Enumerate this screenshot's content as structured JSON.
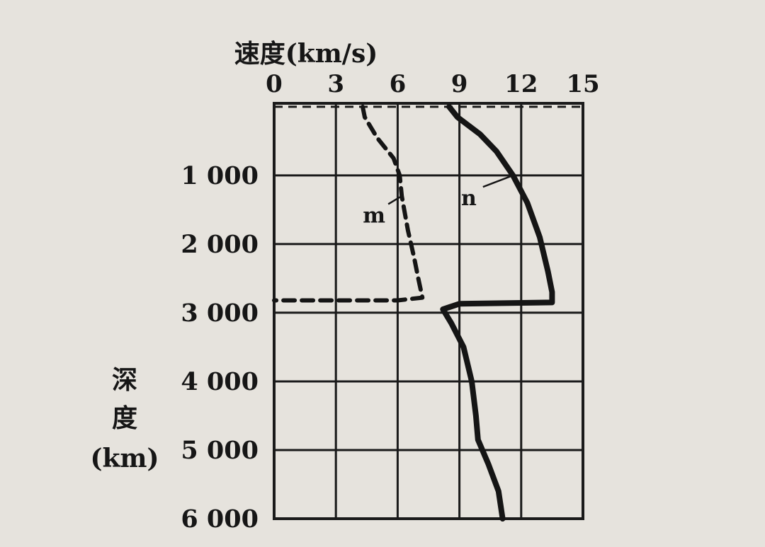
{
  "chart_data": {
    "type": "line",
    "title": "",
    "xlabel": "速度(km/s)",
    "ylabel": {
      "line1": "深",
      "line2": "度",
      "line3": "(km)"
    },
    "x_axis": {
      "position": "top",
      "range": [
        0,
        15
      ],
      "ticks": [
        0,
        3,
        6,
        9,
        12,
        15
      ],
      "tick_labels": [
        "0",
        "3",
        "6",
        "9",
        "12",
        "15"
      ]
    },
    "y_axis": {
      "inverted": true,
      "range": [
        -50,
        6000
      ],
      "ticks": [
        1000,
        2000,
        3000,
        4000,
        5000,
        6000
      ],
      "tick_labels": [
        "1 000",
        "2 000",
        "3 000",
        "4 000",
        "5 000",
        "6 000"
      ]
    },
    "grid": true,
    "series": [
      {
        "name": "m",
        "style": "dashed",
        "points": [
          [
            4.3,
            0
          ],
          [
            4.4,
            150
          ],
          [
            5.0,
            450
          ],
          [
            5.8,
            750
          ],
          [
            6.1,
            1000
          ],
          [
            6.2,
            1300
          ],
          [
            6.5,
            1800
          ],
          [
            6.8,
            2200
          ],
          [
            7.0,
            2500
          ],
          [
            7.2,
            2780
          ],
          [
            6.0,
            2820
          ],
          [
            0,
            2820
          ]
        ]
      },
      {
        "name": "n",
        "style": "solid",
        "points": [
          [
            8.5,
            0
          ],
          [
            8.9,
            150
          ],
          [
            10.0,
            400
          ],
          [
            10.8,
            650
          ],
          [
            11.6,
            1000
          ],
          [
            12.3,
            1400
          ],
          [
            12.9,
            1900
          ],
          [
            13.3,
            2400
          ],
          [
            13.5,
            2700
          ],
          [
            13.5,
            2850
          ],
          [
            9.0,
            2870
          ],
          [
            8.2,
            2950
          ],
          [
            8.6,
            3150
          ],
          [
            9.2,
            3500
          ],
          [
            9.6,
            4000
          ],
          [
            9.8,
            4500
          ],
          [
            9.9,
            4850
          ],
          [
            10.4,
            5200
          ],
          [
            10.9,
            5600
          ],
          [
            11.1,
            6000
          ]
        ]
      }
    ],
    "annotations": [
      {
        "text": "m",
        "series": "m",
        "near": [
          5.2,
          1500
        ]
      },
      {
        "text": "n",
        "series": "n",
        "near": [
          9.8,
          1250
        ]
      }
    ]
  }
}
